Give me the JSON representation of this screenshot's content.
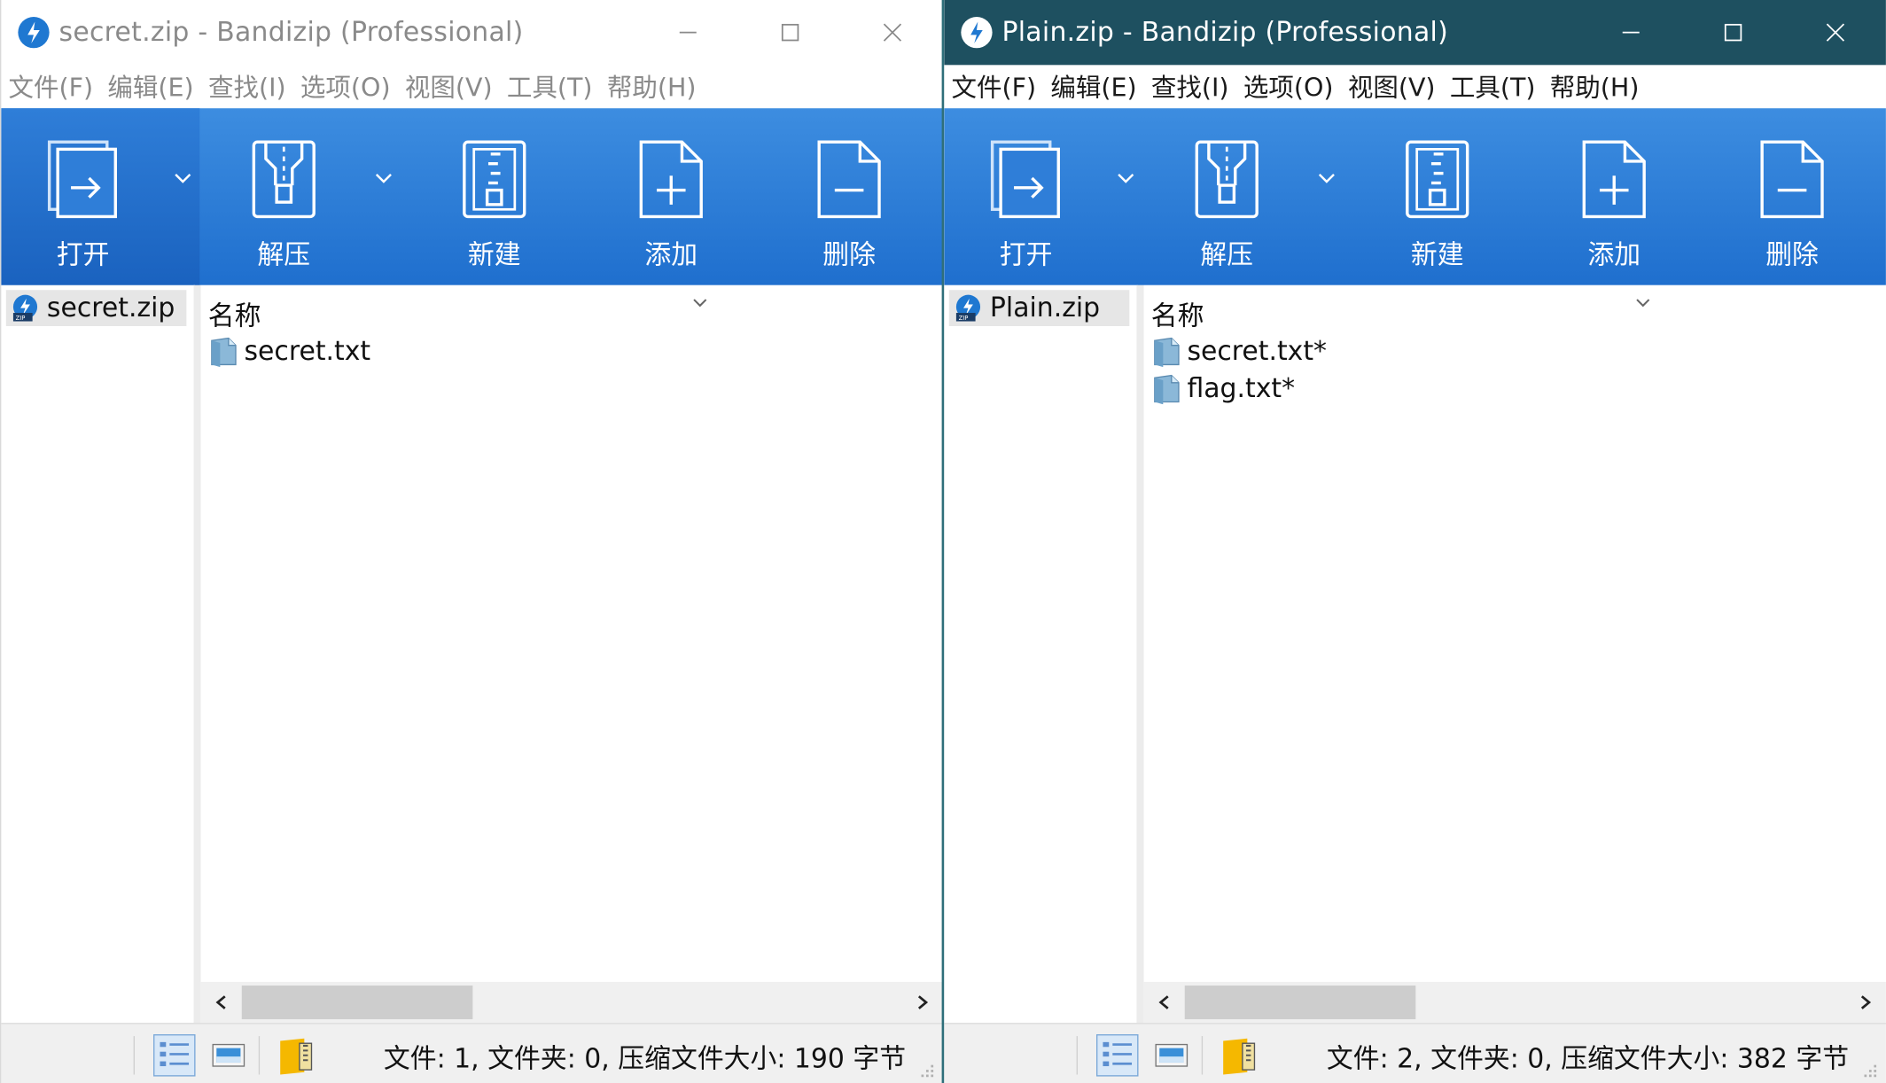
{
  "windows": [
    {
      "title": "secret.zip - Bandizip (Professional)",
      "active": false,
      "menu": [
        "文件(F)",
        "编辑(E)",
        "查找(I)",
        "选项(O)",
        "视图(V)",
        "工具(T)",
        "帮助(H)"
      ],
      "toolbar": {
        "open": "打开",
        "extract": "解压",
        "new": "新建",
        "add": "添加",
        "delete": "删除"
      },
      "tree_item": "secret.zip",
      "column_header": "名称",
      "files": [
        "secret.txt"
      ],
      "status": "文件: 1, 文件夹: 0, 压缩文件大小: 190 字节"
    },
    {
      "title": "Plain.zip - Bandizip (Professional)",
      "active": true,
      "menu": [
        "文件(F)",
        "编辑(E)",
        "查找(I)",
        "选项(O)",
        "视图(V)",
        "工具(T)",
        "帮助(H)"
      ],
      "toolbar": {
        "open": "打开",
        "extract": "解压",
        "new": "新建",
        "add": "添加",
        "delete": "删除"
      },
      "tree_item": "Plain.zip",
      "column_header": "名称",
      "files": [
        "secret.txt*",
        "flag.txt*"
      ],
      "status": "文件: 2, 文件夹: 0, 压缩文件大小: 382 字节"
    }
  ],
  "icons": {
    "app": "bandizip-logo-icon",
    "minimize": "minimize-icon",
    "maximize": "maximize-icon",
    "close": "close-icon",
    "open": "open-archive-icon",
    "extract": "extract-icon",
    "new": "new-archive-icon",
    "add": "add-file-icon",
    "delete": "delete-file-icon",
    "dropdown": "chevron-down-icon",
    "zip": "zip-file-icon",
    "txt": "text-file-icon",
    "details_view": "details-view-icon",
    "preview": "preview-icon",
    "archive": "archive-icon"
  },
  "colors": {
    "toolbar_blue": "#1f6fce",
    "active_title": "#1e5060",
    "inactive_title_text": "#8a8a8a"
  }
}
